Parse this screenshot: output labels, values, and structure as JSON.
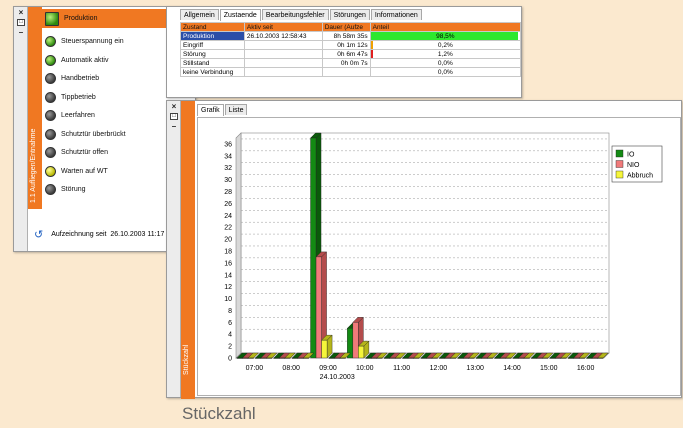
{
  "status_window": {
    "header_label": "Produktion",
    "items": [
      {
        "label": "Steuerspannung ein",
        "lamp": "green"
      },
      {
        "label": "Automatik aktiv",
        "lamp": "green"
      },
      {
        "label": "Handbetrieb",
        "lamp": "gray"
      },
      {
        "label": "Tippbetrieb",
        "lamp": "gray"
      },
      {
        "label": "Leerfahren",
        "lamp": "gray"
      },
      {
        "label": "Schutztür überbrückt",
        "lamp": "gray"
      },
      {
        "label": "Schutztür offen",
        "lamp": "gray"
      },
      {
        "label": "Warten auf WT",
        "lamp": "yellow"
      },
      {
        "label": "Störung",
        "lamp": "gray"
      }
    ],
    "side_title": "1.1 Aufliegen/Entnahme",
    "recording_label": "Aufzeichnung seit",
    "recording_since": "26.10.2003 11:17"
  },
  "table_window": {
    "tabs": [
      "Allgemein",
      "Zustaende",
      "Bearbeitungsfehler",
      "Störungen",
      "Informationen"
    ],
    "active_tab": 1,
    "columns": [
      "Zustand",
      "Aktiv seit",
      "Dauer (Aufze",
      "Anteil"
    ],
    "rows": [
      {
        "zustand": "Produktion",
        "aktiv_seit": "26.10.2003 12:58:43",
        "dauer": "8h 58m 35s",
        "anteil": "98,5%",
        "bar": 0.985,
        "color": "#2ee82e"
      },
      {
        "zustand": "Eingriff",
        "aktiv_seit": "",
        "dauer": "0h 1m 12s",
        "anteil": "0,2%",
        "bar": 0.002,
        "color": "#f0a000"
      },
      {
        "zustand": "Störung",
        "aktiv_seit": "",
        "dauer": "0h 6m 47s",
        "anteil": "1,2%",
        "bar": 0.012,
        "color": "#e02020"
      },
      {
        "zustand": "Stillstand",
        "aktiv_seit": "",
        "dauer": "0h 0m 7s",
        "anteil": "0,0%",
        "bar": 0.0,
        "color": "#888888"
      },
      {
        "zustand": "keine Verbindung",
        "aktiv_seit": "",
        "dauer": "",
        "anteil": "0,0%",
        "bar": 0.0,
        "color": "#888888"
      }
    ]
  },
  "chart_window": {
    "tabs": [
      "Grafik",
      "Liste"
    ],
    "active_tab": 0,
    "side_title": "Stückzahl"
  },
  "caption": "Stückzahl",
  "chart_data": {
    "type": "bar",
    "categories": [
      "07:00",
      "07:30",
      "08:00",
      "08:30",
      "09:00",
      "09:30",
      "10:00",
      "10:30",
      "11:00",
      "11:30",
      "12:00",
      "12:30",
      "13:00",
      "13:30",
      "14:00",
      "14:30",
      "15:00",
      "15:30",
      "16:00",
      "16:30"
    ],
    "tick_labels": [
      "07:00",
      "08:00",
      "09:00",
      "10:00",
      "11:00",
      "12:00",
      "13:00",
      "14:00",
      "15:00",
      "16:00"
    ],
    "date_label": "24.10.2003",
    "series": [
      {
        "name": "IO",
        "color": "#138a13",
        "values": [
          0,
          0,
          0,
          0,
          37,
          0,
          5,
          0,
          0,
          0,
          0,
          0,
          0,
          0,
          0,
          0,
          0,
          0,
          0,
          0
        ]
      },
      {
        "name": "NIO",
        "color": "#f07a7a",
        "values": [
          0,
          0,
          0,
          0,
          17,
          0,
          6,
          0,
          0,
          0,
          0,
          0,
          0,
          0,
          0,
          0,
          0,
          0,
          0,
          0
        ]
      },
      {
        "name": "Abbruch",
        "color": "#f5f53a",
        "values": [
          0,
          0,
          0,
          0,
          3,
          0,
          2,
          0,
          0,
          0,
          0,
          0,
          0,
          0,
          0,
          0,
          0,
          0,
          0,
          0
        ]
      }
    ],
    "ylim": [
      0,
      37
    ],
    "yticks": [
      0,
      2,
      4,
      6,
      8,
      10,
      12,
      14,
      16,
      18,
      20,
      22,
      24,
      26,
      28,
      30,
      32,
      34,
      36
    ],
    "grid": true,
    "legend": "top-right",
    "style": "3d"
  }
}
